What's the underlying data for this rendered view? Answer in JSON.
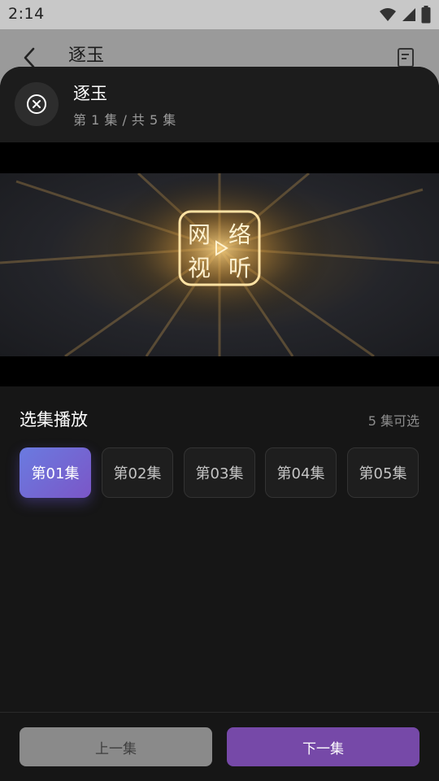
{
  "status_bar": {
    "time": "2:14"
  },
  "underlying_page": {
    "title": "逐玉"
  },
  "sheet": {
    "title": "逐玉",
    "subtitle": "第 1 集 / 共 5 集"
  },
  "video": {
    "logo_text": [
      "网",
      "络",
      "视",
      "听"
    ]
  },
  "episode_section": {
    "title": "选集播放",
    "count": "5 集可选",
    "episodes": [
      {
        "label": "第01集",
        "active": true
      },
      {
        "label": "第02集",
        "active": false
      },
      {
        "label": "第03集",
        "active": false
      },
      {
        "label": "第04集",
        "active": false
      },
      {
        "label": "第05集",
        "active": false
      }
    ]
  },
  "footer": {
    "prev_label": "上一集",
    "next_label": "下一集"
  },
  "colors": {
    "accent": "#7649a8",
    "active_gradient_start": "#6a7be0",
    "active_gradient_end": "#7b56c7",
    "sheet_bg": "#161616"
  },
  "icons": {
    "status": [
      "wifi-icon",
      "signal-icon",
      "battery-icon"
    ],
    "back": "chevron-left-icon",
    "action": "document-history-icon",
    "close": "close-circle-icon"
  }
}
